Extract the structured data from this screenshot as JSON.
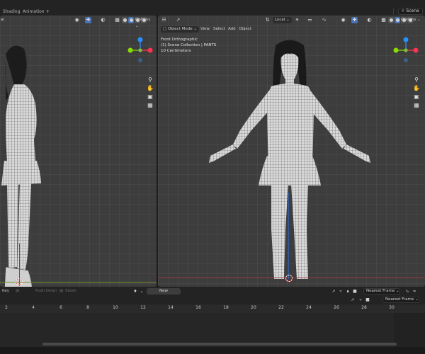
{
  "workspace_tabs": [
    {
      "label": "Shading"
    },
    {
      "label": "Animation"
    },
    {
      "label": "+"
    }
  ],
  "scene": {
    "label": "Scene"
  },
  "left_viewport": {
    "options_label": "Options",
    "header_fragment": "al"
  },
  "right_viewport": {
    "mode_label": "Object Mode",
    "menus": [
      "View",
      "Select",
      "Add",
      "Object"
    ],
    "transform_orientation": "Local",
    "options_label": "Options",
    "info": {
      "view": "Front Orthographic",
      "collection": "(1) Scene Collection | PANTS",
      "scale": "10 Centimeters"
    }
  },
  "gizmo_axes": {
    "x": "X",
    "y": "Y",
    "z": "Z"
  },
  "timeline": {
    "key_label": "Key",
    "push_down": "Push Down",
    "stash": "Stash",
    "new_label": "New",
    "snap_mode": "Nearest Frame",
    "snap_mode_2": "Nearest Frame",
    "ruler": [
      "2",
      "4",
      "6",
      "8",
      "10",
      "12",
      "14",
      "16",
      "18",
      "20",
      "22",
      "24",
      "26",
      "28",
      "30"
    ]
  },
  "colors": {
    "x_axis": "#ff3352",
    "y_axis": "#8bdc00",
    "z_axis": "#2890ff",
    "active_blue": "#4772b3",
    "viewport_bg": "#3d3d3d"
  }
}
